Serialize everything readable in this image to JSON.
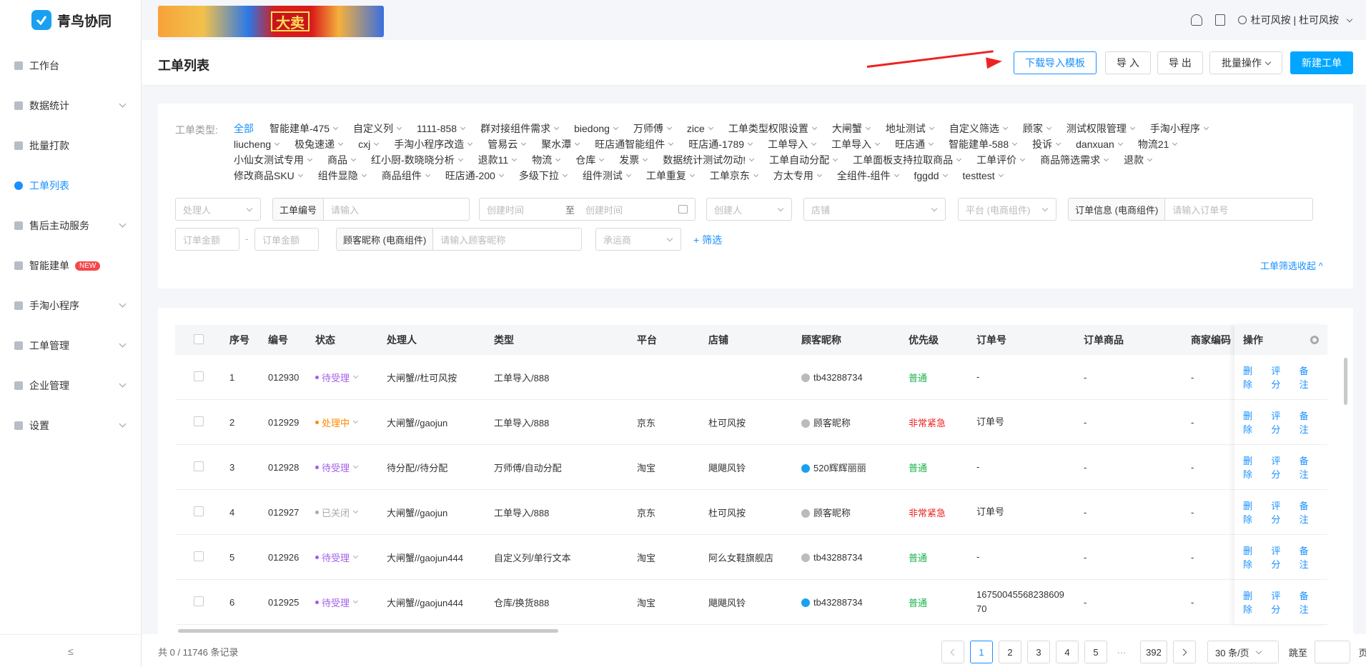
{
  "app": {
    "name": "青鸟协同"
  },
  "sidebar": {
    "items": [
      {
        "label": "工作台"
      },
      {
        "label": "数据统计"
      },
      {
        "label": "批量打款"
      },
      {
        "label": "工单列表"
      },
      {
        "label": "售后主动服务"
      },
      {
        "label": "智能建单",
        "badge": "NEW"
      },
      {
        "label": "手淘小程序"
      },
      {
        "label": "工单管理"
      },
      {
        "label": "企业管理"
      },
      {
        "label": "设置"
      }
    ],
    "collapse_icon": "≤"
  },
  "banner": {
    "text": "大卖"
  },
  "topbar": {
    "user_label": "杜可风按 | 杜可风按"
  },
  "header": {
    "title": "工单列表",
    "buttons": {
      "download_template": "下载导入模板",
      "import": "导 入",
      "export": "导 出",
      "batch": "批量操作",
      "create": "新建工单"
    }
  },
  "filters": {
    "type_label": "工单类型:",
    "type_lines": [
      [
        "全部",
        "智能建单-475",
        "自定义列",
        "1111-858",
        "群对接组件需求",
        "biedong",
        "万师傅",
        "zice",
        "工单类型权限设置",
        "大闸蟹",
        "地址测试",
        "自定义筛选",
        "顾家",
        "测试权限管理",
        "手淘小程序"
      ],
      [
        "liucheng",
        "极兔速递",
        "cxj",
        "手淘小程序改造",
        "管易云",
        "聚水潭",
        "旺店通智能组件",
        "旺店通-1789",
        "工单导入",
        "工单导入",
        "旺店通",
        "智能建单-588",
        "投诉",
        "danxuan",
        "物流21"
      ],
      [
        "小仙女测试专用",
        "商品",
        "红小厨-数晓晓分析",
        "退款11",
        "物流",
        "仓库",
        "发票",
        "数据统计测试勿动!",
        "工单自动分配",
        "工单面板支持拉取商品",
        "工单评价",
        "商品筛选需求",
        "退款"
      ],
      [
        "修改商品SKU",
        "组件显隐",
        "商品组件",
        "旺店通-200",
        "多级下拉",
        "组件测试",
        "工单重复",
        "工单京东",
        "方太专用",
        "全组件-组件",
        "fggdd",
        "testtest"
      ]
    ],
    "handler_placeholder": "处理人",
    "order_no_label": "工单编号",
    "order_no_placeholder": "请输入",
    "created_start": "创建时间",
    "created_sep": "至",
    "created_end": "创建时间",
    "creator_placeholder": "创建人",
    "shop_placeholder": "店铺",
    "platform_placeholder": "平台 (电商组件)",
    "order_info_label": "订单信息 (电商组件)",
    "order_info_placeholder": "请输入订单号",
    "amount_min": "订单金额",
    "amount_sep": "-",
    "amount_max": "订单金额",
    "nick_label": "顾客昵称 (电商组件)",
    "nick_placeholder": "请输入顾客昵称",
    "carrier_placeholder": "承运商",
    "add_filter": "+ 筛选",
    "collapse": "工单筛选收起 ^"
  },
  "table": {
    "columns": [
      "序号",
      "编号",
      "状态",
      "处理人",
      "类型",
      "平台",
      "店铺",
      "顾客昵称",
      "优先级",
      "订单号",
      "订单商品",
      "商家编码",
      "操作"
    ],
    "rows": [
      {
        "idx": "1",
        "no": "012930",
        "status": "待受理",
        "status_color": "#a35ee8",
        "handler": "大闸蟹//杜可风按",
        "type": "工单导入/888",
        "platform": "",
        "shop": "",
        "nick": "tb43288734",
        "av_color": "#bbbbbb",
        "priority": "普通",
        "prio_color": "#19b34a",
        "order": "-",
        "goods": "-",
        "code": "-"
      },
      {
        "idx": "2",
        "no": "012929",
        "status": "处理中",
        "status_color": "#ff8a00",
        "handler": "大闸蟹//gaojun",
        "type": "工单导入/888",
        "platform": "京东",
        "shop": "杜可风按",
        "nick": "顾客昵称",
        "av_color": "#bbbbbb",
        "priority": "非常紧急",
        "prio_color": "#ee2222",
        "order": "订单号",
        "goods": "-",
        "code": "-"
      },
      {
        "idx": "3",
        "no": "012928",
        "status": "待受理",
        "status_color": "#a35ee8",
        "handler": "待分配//待分配",
        "type": "万师傅/自动分配",
        "platform": "淘宝",
        "shop": "飓飓风铃",
        "nick": "520辉辉丽丽",
        "av_color": "#1aa0f0",
        "priority": "普通",
        "prio_color": "#19b34a",
        "order": "-",
        "goods": "-",
        "code": "-"
      },
      {
        "idx": "4",
        "no": "012927",
        "status": "已关闭",
        "status_color": "#aaaaaa",
        "handler": "大闸蟹//gaojun",
        "type": "工单导入/888",
        "platform": "京东",
        "shop": "杜可风按",
        "nick": "顾客昵称",
        "av_color": "#bbbbbb",
        "priority": "非常紧急",
        "prio_color": "#ee2222",
        "order": "订单号",
        "goods": "-",
        "code": "-"
      },
      {
        "idx": "5",
        "no": "012926",
        "status": "待受理",
        "status_color": "#a35ee8",
        "handler": "大闸蟹//gaojun444",
        "type": "自定义列/单行文本",
        "platform": "淘宝",
        "shop": "阿么女鞋旗舰店",
        "nick": "tb43288734",
        "av_color": "#bbbbbb",
        "priority": "普通",
        "prio_color": "#19b34a",
        "order": "-",
        "goods": "-",
        "code": "-"
      },
      {
        "idx": "6",
        "no": "012925",
        "status": "待受理",
        "status_color": "#a35ee8",
        "handler": "大闸蟹//gaojun444",
        "type": "仓库/换货888",
        "platform": "淘宝",
        "shop": "飓飓风铃",
        "nick": "tb43288734",
        "av_color": "#1aa0f0",
        "priority": "普通",
        "prio_color": "#19b34a",
        "order": "1675004556823860970",
        "goods": "-",
        "code": "-"
      }
    ],
    "actions": [
      "删除",
      "评分",
      "备注"
    ]
  },
  "footer": {
    "total": "共 0 / 11746 条记录",
    "pages": [
      "1",
      "2",
      "3",
      "4",
      "5"
    ],
    "ellipsis": "···",
    "last_page": "392",
    "page_size": "30 条/页",
    "jump_label": "跳至",
    "page_unit": "页",
    "current_page": "1"
  },
  "colors": {
    "accent": "#1890ff",
    "primary_button": "#00a6ff",
    "arrow": "#ee2222"
  }
}
